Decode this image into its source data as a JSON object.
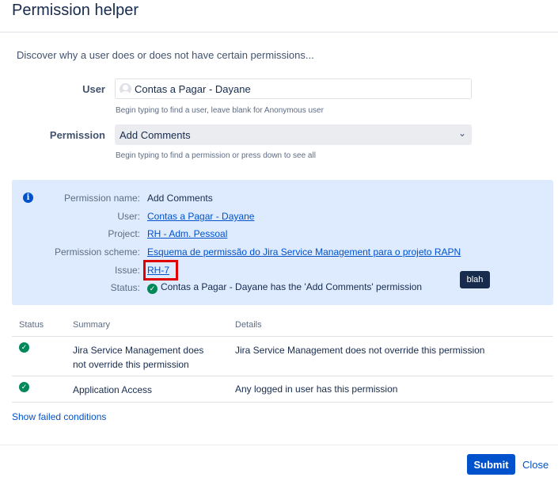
{
  "dialog": {
    "title": "Permission helper"
  },
  "intro": "Discover why a user does or does not have certain permissions...",
  "form": {
    "user_label": "User",
    "user_value": "Contas a Pagar - Dayane",
    "user_hint": "Begin typing to find a user, leave blank for Anonymous user",
    "permission_label": "Permission",
    "permission_value": "Add Comments",
    "permission_hint": "Begin typing to find a permission or press down to see all"
  },
  "info": {
    "permission_name_label": "Permission name:",
    "permission_name": "Add Comments",
    "user_label": "User:",
    "user": "Contas a Pagar - Dayane",
    "project_label": "Project:",
    "project": "RH - Adm. Pessoal",
    "scheme_label": "Permission scheme:",
    "scheme": "Esquema de permissão do Jira Service Management para o projeto RAPN",
    "issue_label": "Issue:",
    "issue": "RH-7",
    "status_label": "Status:",
    "status": "Contas a Pagar - Dayane has the 'Add Comments' permission"
  },
  "tooltip": "blah",
  "table": {
    "headers": [
      "Status",
      "Summary",
      "Details"
    ],
    "rows": [
      {
        "summary": "Jira Service Management does not override this permission",
        "details": "Jira Service Management does not override this permission"
      },
      {
        "summary": "Application Access",
        "details": "Any logged in user has this permission"
      }
    ]
  },
  "show_failed": "Show failed conditions",
  "footer": {
    "submit": "Submit",
    "close": "Close"
  },
  "colors": {
    "accent": "#0052cc",
    "info_bg": "#deebff",
    "success": "#00875a",
    "highlight": "#e00000"
  },
  "icons": {
    "info": "info-icon",
    "check": "check-circle-icon",
    "avatar": "user-avatar-icon",
    "chevron": "chevron-down-icon"
  }
}
